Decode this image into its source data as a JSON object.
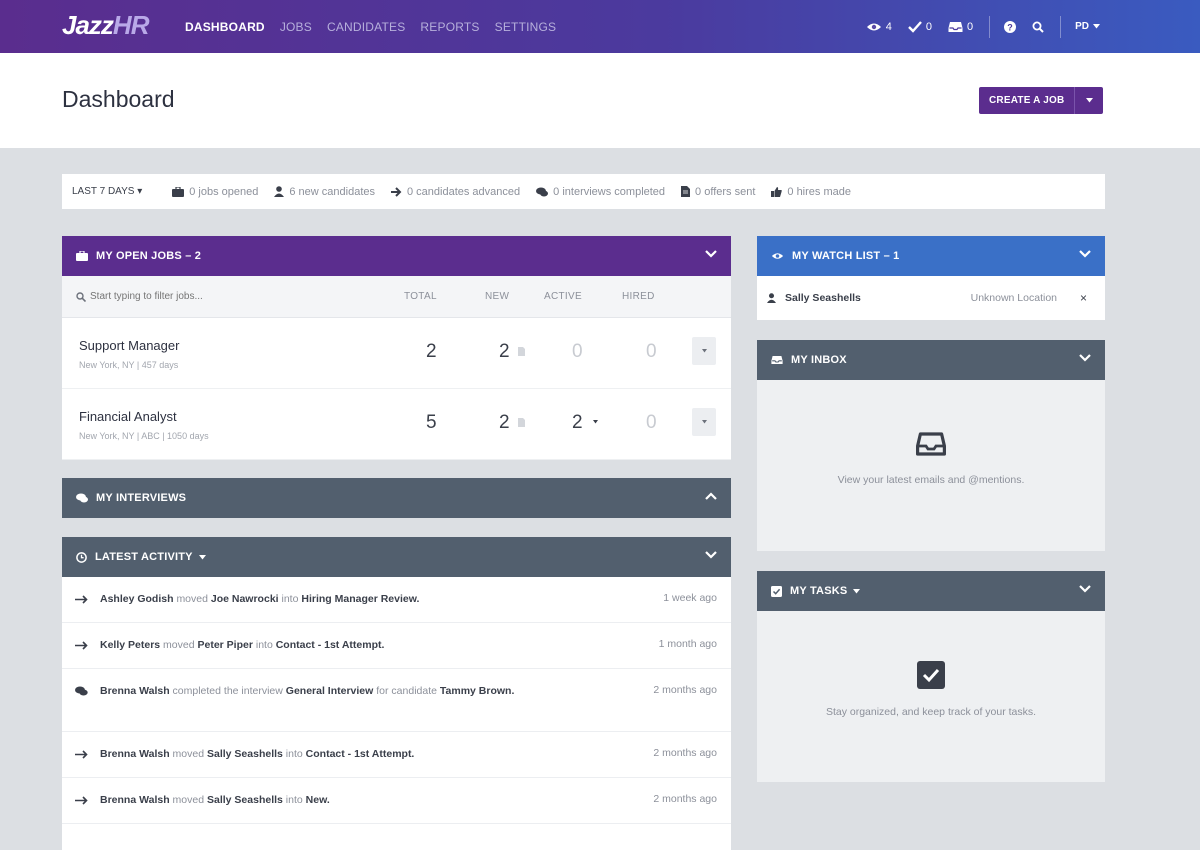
{
  "app": {
    "logo_main": "Jazz",
    "logo_accent": "HR"
  },
  "nav": [
    {
      "label": "DASHBOARD",
      "active": true
    },
    {
      "label": "JOBS",
      "active": false
    },
    {
      "label": "CANDIDATES",
      "active": false
    },
    {
      "label": "REPORTS",
      "active": false
    },
    {
      "label": "SETTINGS",
      "active": false
    }
  ],
  "toolbar": {
    "watch_count": "4",
    "tasks_count": "0",
    "inbox_count": "0",
    "user_initials": "PD"
  },
  "page": {
    "title": "Dashboard",
    "create_button": "CREATE A JOB"
  },
  "stats": {
    "period": "LAST 7 DAYS",
    "items": [
      {
        "icon": "briefcase-icon",
        "text": "0 jobs opened"
      },
      {
        "icon": "person-icon",
        "text": "6 new candidates"
      },
      {
        "icon": "arrow-right-icon",
        "text": "0 candidates advanced"
      },
      {
        "icon": "chat-icon",
        "text": "0 interviews completed"
      },
      {
        "icon": "document-icon",
        "text": "0 offers sent"
      },
      {
        "icon": "thumbs-up-icon",
        "text": "0 hires made"
      }
    ]
  },
  "open_jobs": {
    "title": "MY OPEN JOBS – 2",
    "search_placeholder": "Start typing to filter jobs...",
    "columns": [
      "TOTAL",
      "NEW",
      "ACTIVE",
      "HIRED"
    ],
    "rows": [
      {
        "name": "Support Manager",
        "meta": "New York, NY | 457 days",
        "total": "2",
        "new": "2",
        "active": "0",
        "hired": "0"
      },
      {
        "name": "Financial Analyst",
        "meta": "New York, NY | ABC | 1050 days",
        "total": "5",
        "new": "2",
        "active": "2",
        "hired": "0"
      }
    ]
  },
  "interviews": {
    "title": "MY INTERVIEWS"
  },
  "activity": {
    "title": "LATEST ACTIVITY",
    "items": [
      {
        "icon": "arrow-right-icon",
        "actor": "Ashley Godish",
        "verb": "moved",
        "subject": "Joe Nawrocki",
        "prep": "into",
        "target": "Hiring Manager Review.",
        "time": "1 week ago"
      },
      {
        "icon": "arrow-right-icon",
        "actor": "Kelly Peters",
        "verb": "moved",
        "subject": "Peter Piper",
        "prep": "into",
        "target": "Contact - 1st Attempt.",
        "time": "1 month ago"
      },
      {
        "icon": "chat-icon",
        "actor": "Brenna Walsh",
        "verb": "completed the interview",
        "subject": "General Interview",
        "prep": "for candidate",
        "target": "Tammy Brown.",
        "time": "2 months ago"
      },
      {
        "icon": "arrow-right-icon",
        "actor": "Brenna Walsh",
        "verb": "moved",
        "subject": "Sally Seashells",
        "prep": "into",
        "target": "Contact - 1st Attempt.",
        "time": "2 months ago"
      },
      {
        "icon": "arrow-right-icon",
        "actor": "Brenna Walsh",
        "verb": "moved",
        "subject": "Sally Seashells",
        "prep": "into",
        "target": "New.",
        "time": "2 months ago"
      }
    ]
  },
  "watch_list": {
    "title": "MY WATCH LIST – 1",
    "items": [
      {
        "name": "Sally Seashells",
        "location": "Unknown Location"
      }
    ]
  },
  "inbox": {
    "title": "MY INBOX",
    "empty_text": "View your latest emails and @mentions."
  },
  "tasks": {
    "title": "MY TASKS",
    "empty_text": "Stay organized, and keep track of your tasks."
  },
  "colors": {
    "purple": "#5b2d8e",
    "slate": "#525f6e",
    "blue": "#3a70c7"
  }
}
